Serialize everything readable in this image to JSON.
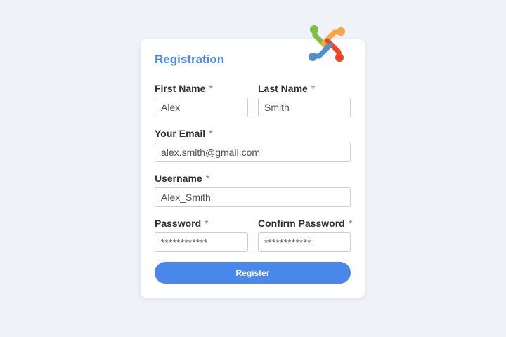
{
  "form": {
    "title": "Registration",
    "required_marker": "*",
    "fields": {
      "first_name": {
        "label": "First Name",
        "value": "Alex"
      },
      "last_name": {
        "label": "Last Name",
        "value": "Smith"
      },
      "email": {
        "label": "Your Email",
        "value": "alex.smith@gmail.com"
      },
      "username": {
        "label": "Username",
        "value": "Alex_Smith"
      },
      "password": {
        "label": "Password",
        "value": "************"
      },
      "confirm_password": {
        "label": "Confirm Password",
        "value": "************"
      }
    },
    "submit_label": "Register"
  },
  "logo": {
    "icon": "joomla-logo",
    "colors": [
      "#7ac143",
      "#f9a541",
      "#f44321",
      "#5091cd"
    ]
  },
  "colors": {
    "accent": "#4a87ea",
    "required": "#e25555",
    "background": "#eff2f7"
  }
}
